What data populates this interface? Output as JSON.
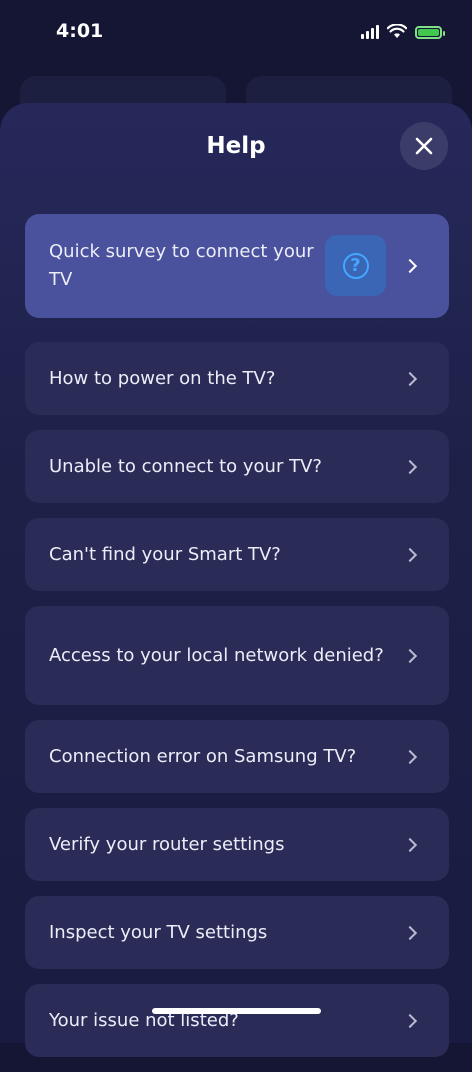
{
  "status_bar": {
    "time": "4:01"
  },
  "sheet": {
    "title": "Help",
    "close_icon": "close-icon"
  },
  "help_items": [
    {
      "label": "Quick survey to connect your TV",
      "highlight": true,
      "icon": "question-circle-icon"
    },
    {
      "label": "How to power on the TV?"
    },
    {
      "label": "Unable to connect to your TV?"
    },
    {
      "label": "Can't find your Smart TV?"
    },
    {
      "label": "Access to your local network denied?"
    },
    {
      "label": "Connection error on Samsung TV?"
    },
    {
      "label": "Verify your router settings"
    },
    {
      "label": "Inspect your TV settings"
    },
    {
      "label": "Your issue not listed?"
    }
  ],
  "colors": {
    "background": "#151633",
    "sheet": "#1e2048",
    "item": "#2a2c57",
    "highlight_item": "#4a519d",
    "accent_blue": "#43a6ff"
  }
}
